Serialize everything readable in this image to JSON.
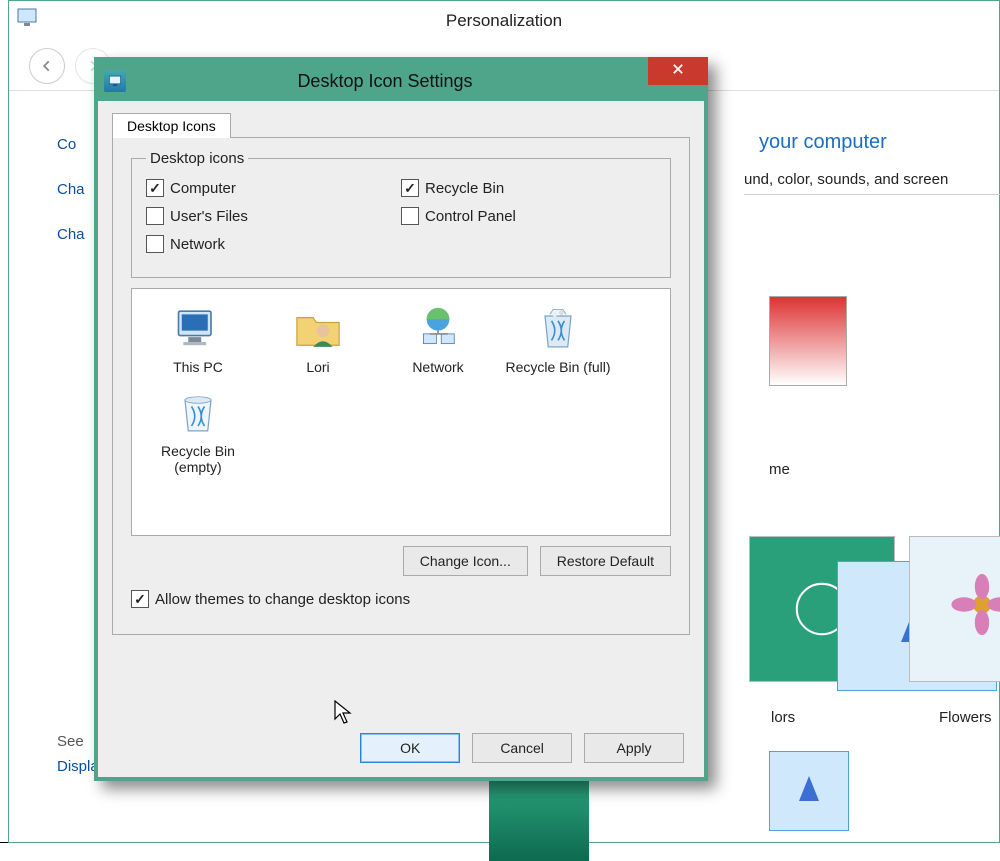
{
  "parent_window": {
    "title": "Personalization",
    "left_links": [
      "Co",
      "Cha",
      "Cha"
    ],
    "see_also": "See",
    "display_link": "Display",
    "right_heading_fragment": "your computer",
    "right_sub_fragment": "und, color, sounds, and screen",
    "theme_label_fragment_me": "me",
    "theme_label_lors": "lors",
    "theme_label_flowers": "Flowers"
  },
  "dialog": {
    "title": "Desktop Icon Settings",
    "tab_label": "Desktop Icons",
    "group_legend": "Desktop icons",
    "checkboxes": {
      "computer": {
        "label": "Computer",
        "checked": true
      },
      "users_files": {
        "label": "User's Files",
        "checked": false
      },
      "network": {
        "label": "Network",
        "checked": false
      },
      "recycle_bin": {
        "label": "Recycle Bin",
        "checked": true
      },
      "control_panel": {
        "label": "Control Panel",
        "checked": false
      }
    },
    "icons": [
      {
        "label": "This PC"
      },
      {
        "label": "Lori"
      },
      {
        "label": "Network"
      },
      {
        "label": "Recycle Bin (full)"
      },
      {
        "label": "Recycle Bin (empty)"
      }
    ],
    "change_icon_btn": "Change Icon...",
    "restore_default_btn": "Restore Default",
    "allow_themes": {
      "label": "Allow themes to change desktop icons",
      "checked": true
    },
    "ok_btn": "OK",
    "cancel_btn": "Cancel",
    "apply_btn": "Apply"
  }
}
